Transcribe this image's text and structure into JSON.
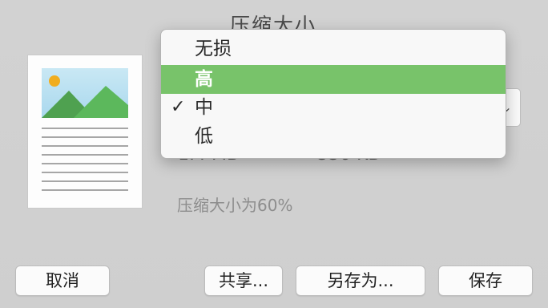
{
  "dialog": {
    "heading": "压缩大小",
    "size_before": "1.4 MB",
    "size_after": "550 KB",
    "ratio_text": "压缩大小为60%"
  },
  "menu": {
    "items": [
      {
        "label": "无损",
        "checked": false,
        "highlighted": false
      },
      {
        "label": "高",
        "checked": false,
        "highlighted": true
      },
      {
        "label": "中",
        "checked": true,
        "highlighted": false
      },
      {
        "label": "低",
        "checked": false,
        "highlighted": false
      }
    ],
    "check_glyph": "✓",
    "highlight_color": "#78c36a"
  },
  "buttons": {
    "cancel": "取消",
    "share": "共享...",
    "save_as": "另存为...",
    "save": "保存"
  },
  "icons": {
    "thumbnail": "document-thumbnail-icon",
    "select_chevron": "chevron-down-icon"
  }
}
